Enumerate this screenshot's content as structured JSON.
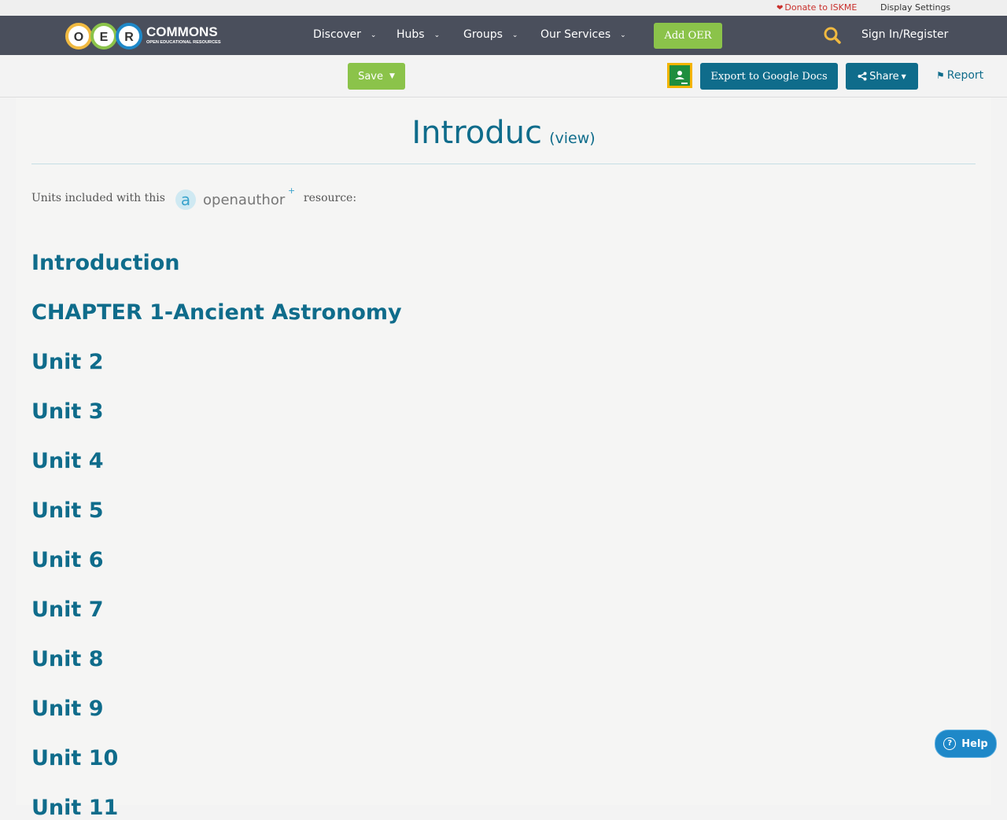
{
  "topbar": {
    "donate_label": "Donate to ISKME",
    "display_settings_label": "Display Settings"
  },
  "nav": {
    "logo_letters": [
      "O",
      "E",
      "R"
    ],
    "logo_title": "COMMONS",
    "logo_subtitle": "OPEN EDUCATIONAL RESOURCES",
    "items": [
      {
        "label": "Discover"
      },
      {
        "label": "Hubs"
      },
      {
        "label": "Groups"
      },
      {
        "label": "Our Services"
      }
    ],
    "add_oer_label": "Add OER",
    "search_icon": "search-icon",
    "signin_label": "Sign In/Register"
  },
  "toolbar": {
    "save_label": "Save",
    "classroom_icon": "google-classroom-icon",
    "export_label": "Export to Google Docs",
    "share_label": "Share",
    "report_label": "Report"
  },
  "page": {
    "title": "Introduc",
    "view_label": "(view)",
    "units_prefix": "Units included with this",
    "openauthor_logo": "openauthor",
    "units_suffix": "resource:",
    "units": [
      "Introduction",
      "CHAPTER 1-Ancient Astronomy",
      "Unit 2",
      "Unit 3",
      "Unit 4",
      "Unit 5",
      "Unit 6",
      "Unit 7",
      "Unit 8",
      "Unit 9",
      "Unit 10",
      "Unit 11"
    ]
  },
  "help": {
    "label": "Help"
  },
  "colors": {
    "nav_bg": "#4a4f5c",
    "accent_green": "#8bc34a",
    "primary_blue": "#0f6c8b",
    "help_blue": "#1e88c8",
    "donate_red": "#c9302c"
  }
}
